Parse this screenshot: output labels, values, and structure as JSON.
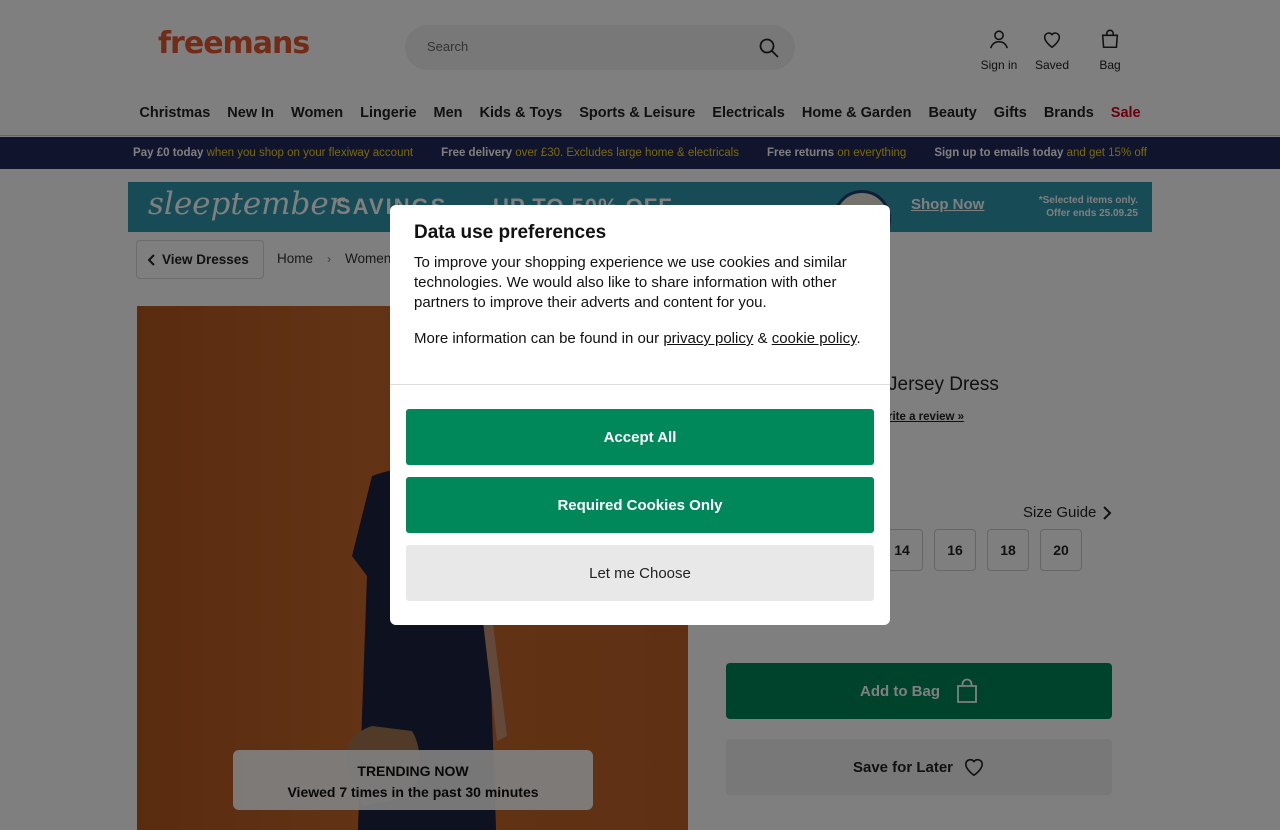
{
  "header": {
    "logo": "freemans",
    "search_placeholder": "Search",
    "sign_in": "Sign in",
    "saved": "Saved",
    "bag": "Bag"
  },
  "nav": {
    "items": [
      "Christmas",
      "New In",
      "Women",
      "Lingerie",
      "Men",
      "Kids & Toys",
      "Sports & Leisure",
      "Electricals",
      "Home & Garden",
      "Beauty",
      "Gifts",
      "Brands"
    ],
    "sale": "Sale"
  },
  "promo": [
    {
      "bold": "Pay £0 today",
      "rest": " when you shop on your flexiway account"
    },
    {
      "bold": "Free delivery",
      "rest": " over £30. Excludes large home & electricals"
    },
    {
      "bold": "Free returns",
      "rest": " on everything"
    },
    {
      "bold": "Sign up to emails today",
      "rest": " and get 15% off"
    }
  ],
  "banner": {
    "script": "sleeptember",
    "savings": "SAVINGS",
    "off": "UP TO 50% OFF",
    "shop_now": "Shop Now",
    "note_line1": "*Selected items only.",
    "note_line2": "Offer ends 25.09.25"
  },
  "breadcrumb": {
    "back": "View Dresses",
    "items": [
      "Home",
      "Women"
    ]
  },
  "product": {
    "title_visible": "Jersey Dress",
    "review_link": "rite a review »",
    "size_guide": "Size Guide",
    "sizes_visible": [
      "14",
      "16",
      "18",
      "20"
    ],
    "add_to_bag": "Add to Bag",
    "save_for_later": "Save for Later",
    "trending_title": "TRENDING NOW",
    "trending_text": "Viewed 7 times in the past 30 minutes"
  },
  "modal": {
    "title": "Data use preferences",
    "body": "To improve your shopping experience we use cookies and similar technologies. We would also like to share information with other partners to improve their adverts and content for you.",
    "more_prefix": "More information can be found in our ",
    "privacy_link": "privacy policy",
    "and": " & ",
    "cookie_link": "cookie policy",
    "more_suffix": ".",
    "accept_all": "Accept All",
    "required_only": "Required Cookies Only",
    "let_me_choose": "Let me Choose"
  },
  "colors": {
    "brand": "#e4572e",
    "primary_green": "#00875a",
    "promo_bg": "#22285a",
    "promo_highlight": "#f2d31b",
    "sale_red": "#d0021b"
  }
}
